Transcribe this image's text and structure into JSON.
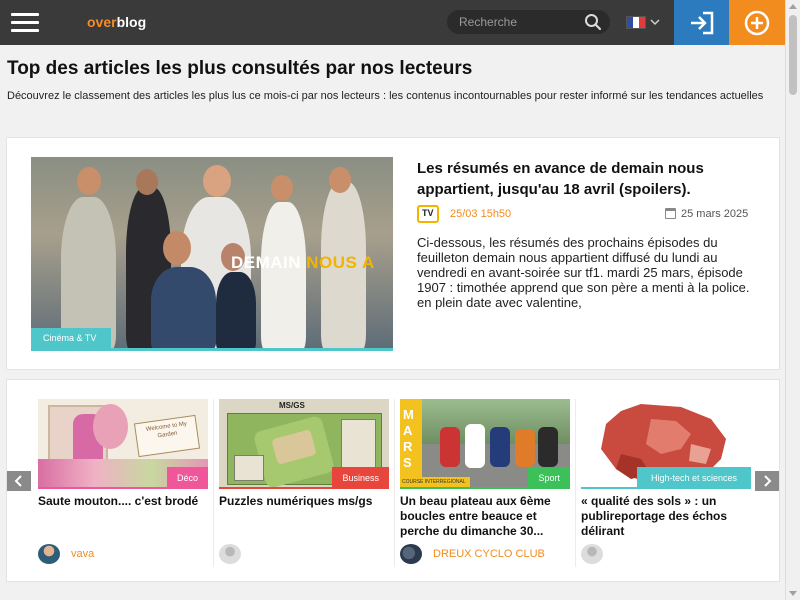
{
  "header": {
    "logo_over": "over",
    "logo_blog": "blog",
    "search_placeholder": "Recherche",
    "language": "fr",
    "colors": {
      "bar": "#3a3a3a",
      "login": "#2d7bbf",
      "add": "#f28c1e",
      "logo_accent": "#f28c28"
    }
  },
  "page": {
    "title": "Top des articles les plus consultés par nos lecteurs",
    "description": "Découvrez le classement des articles les plus lus ce mois-ci par nos lecteurs : les contenus incontournables pour rester informé sur les tendances actuelles"
  },
  "featured": {
    "image_banner_a": "DEMAIN ",
    "image_banner_b": "NOUS A",
    "category": "Cinéma & TV",
    "title": "Les résumés en avance de demain nous appartient, jusqu'au 18 avril (spoilers).",
    "source_icon": "TV",
    "time": "25/03 15h50",
    "date": "25 mars 2025",
    "excerpt": "Ci-dessous, les résumés des prochains épisodes du feuilleton demain nous appartient diffusé du lundi au vendredi en avant-soirée sur tf1. mardi 25 mars, épisode 1907 : timothée apprend que son père a menti à la police. en plein date avec valentine,"
  },
  "carousel": {
    "cards": [
      {
        "title": "Saute mouton.... c'est brodé",
        "category": "Déco",
        "category_color": "#f0569a",
        "author": "vava",
        "image_sign": "Welcome to My Garden"
      },
      {
        "title": "Puzzles numériques ms/gs",
        "category": "Business",
        "category_color": "#e8453c",
        "author": "",
        "image_caption": "MS/GS"
      },
      {
        "title": "Un beau plateau aux 6ème boucles entre beauce et perche du dimanche 30...",
        "category": "Sport",
        "category_color": "#3cc05a",
        "author": "DREUX CYCLO CLUB",
        "image_side_text": "MARS",
        "image_caption": "COURSE INTERREGIONAL"
      },
      {
        "title": "« qualité des sols » : un publireportage des échos délirant",
        "category": "High-tech et sciences",
        "category_color": "#4fc6c9",
        "author": ""
      }
    ]
  }
}
